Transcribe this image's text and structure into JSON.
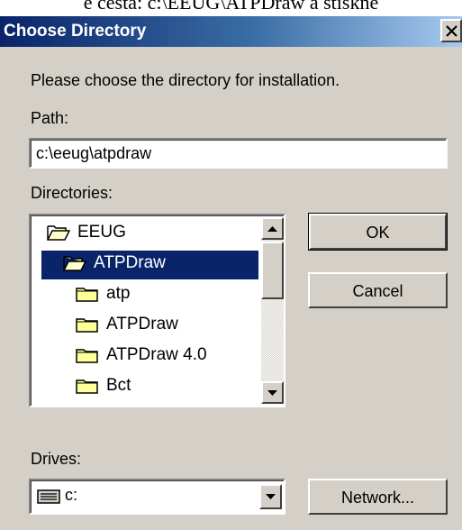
{
  "page_caption": "e cesta: c:\\EEUG\\ATPDraw a stiskne",
  "dialog": {
    "title": "Choose Directory",
    "close_icon": "close-icon",
    "instruction": "Please choose the directory for installation.",
    "path_label": "Path:",
    "path_value": "c:\\eeug\\atpdraw",
    "directories_label": "Directories:",
    "directories": [
      {
        "label": "EEUG",
        "icon": "open-folder-icon",
        "selected": false
      },
      {
        "label": "ATPDraw",
        "icon": "open-folder-icon",
        "selected": true
      },
      {
        "label": "atp",
        "icon": "folder-icon",
        "selected": false
      },
      {
        "label": "ATPDraw",
        "icon": "folder-icon",
        "selected": false
      },
      {
        "label": "ATPDraw 4.0",
        "icon": "folder-icon",
        "selected": false
      },
      {
        "label": "Bct",
        "icon": "folder-icon",
        "selected": false
      }
    ],
    "ok_label": "OK",
    "cancel_label": "Cancel",
    "drives_label": "Drives:",
    "drive_value": "c:",
    "network_label": "Network...",
    "colors": {
      "face": "#d4d0c8",
      "selection": "#0a246a",
      "title_start": "#0a246a",
      "title_end": "#a6caf0"
    }
  }
}
